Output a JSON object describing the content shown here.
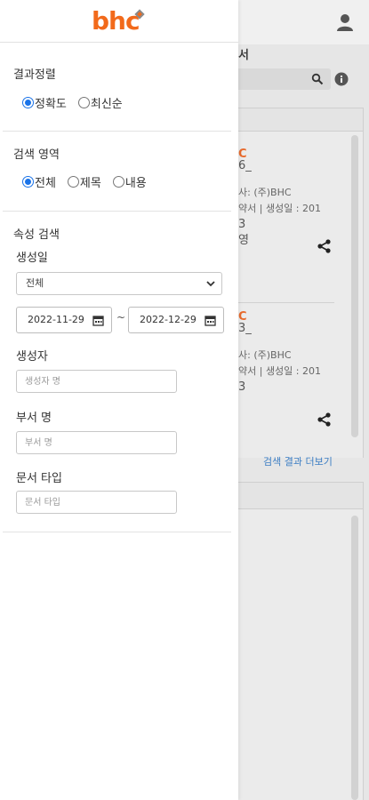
{
  "background": {
    "title": "서",
    "card1": {
      "brand": "C",
      "line1": "6_",
      "line2": "사: (주)BHC",
      "line3": "약서  |  생성일 : 201",
      "line4": "3",
      "line5": "영"
    },
    "card2": {
      "brand": "C",
      "line1": "3_",
      "line2": "사: (주)BHC",
      "line3": "약서  |  생성일 : 201",
      "line4": "3"
    },
    "more_results": "검색 결과 더보기"
  },
  "drawer": {
    "logo": "bhc",
    "sort": {
      "title": "결과정렬",
      "options": [
        "정확도",
        "최신순"
      ],
      "selected": "정확도"
    },
    "area": {
      "title": "검색 영역",
      "options": [
        "전체",
        "제목",
        "내용"
      ],
      "selected": "전체"
    },
    "attr": {
      "title": "속성 검색",
      "created_date_label": "생성일",
      "created_date_select": "전체",
      "date_from": "2022-11-29",
      "date_tilde": "~",
      "date_to": "2022-12-29",
      "creator_label": "생성자",
      "creator_placeholder": "생성자 명",
      "dept_label": "부서 명",
      "dept_placeholder": "부서 명",
      "doctype_label": "문서 타입",
      "doctype_placeholder": "문서 타입"
    }
  },
  "colors": {
    "brand": "#f26a1b",
    "accent": "#1a73e8",
    "link": "#3b7dc4"
  }
}
